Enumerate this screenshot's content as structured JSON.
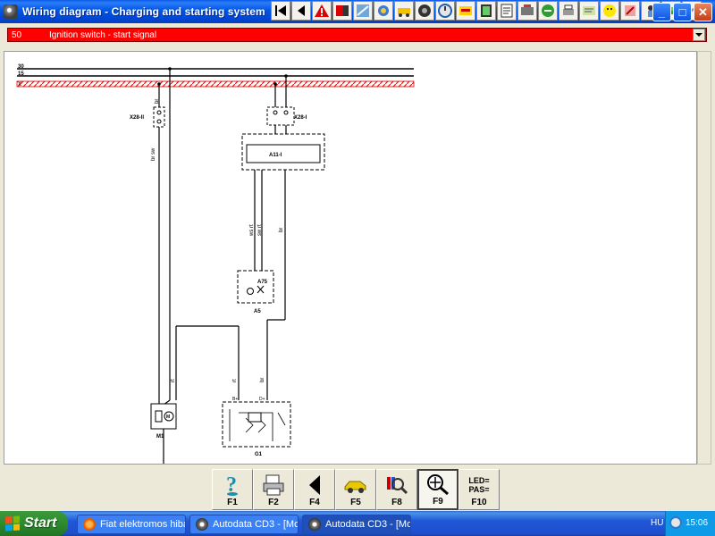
{
  "window": {
    "title": "Wiring diagram - Charging and starting system",
    "min_label": "_",
    "max_label": "□",
    "close_label": "✕"
  },
  "toolbar_icons": [
    "skip-back-icon",
    "back-icon",
    "warning-icon",
    "multimeter-icon",
    "sensor-icon",
    "tool-icon",
    "settings-icon",
    "wheel-icon",
    "timing-icon",
    "gauge-icon",
    "filter-icon",
    "document-icon",
    "engine-icon",
    "components-icon",
    "printer-icon",
    "notes-icon",
    "layout-icon",
    "help-icon",
    "info-icon",
    "car-icon",
    "exit-icon"
  ],
  "signal": {
    "number": "50",
    "label": "Ignition switch - start signal"
  },
  "diagram": {
    "bus": [
      "30",
      "15",
      "X"
    ],
    "conn_left": "X28-II",
    "conn_right": "X28-I",
    "module": "A11-I",
    "a5_code": "A75",
    "a5": "A5",
    "m1": "M1",
    "g1": "G1",
    "wire_br": "br",
    "wire_br_sw": "br sw",
    "wire_rt": "rt",
    "wire_wsrt": "ws rt",
    "wire_swrt": "sw rt",
    "pin_m": "M",
    "pin_b": "B+",
    "pin_d": "D+"
  },
  "fkeys": [
    {
      "label": "F1",
      "icon": "help-icon"
    },
    {
      "label": "F2",
      "icon": "print-icon"
    },
    {
      "label": "F4",
      "icon": "back-arrow-icon"
    },
    {
      "label": "F5",
      "icon": "car-icon"
    },
    {
      "label": "F8",
      "icon": "component-search-icon"
    },
    {
      "label": "F9",
      "icon": "zoom-icon"
    },
    {
      "label": "F10",
      "icon": "led-pas-icon",
      "text1": "LED=",
      "text2": "PAS="
    }
  ],
  "taskbar": {
    "start": "Start",
    "tasks": [
      {
        "label": "Fiat elektromos hiba -...",
        "active": false
      },
      {
        "label": "Autodata CD3 - [Mod...",
        "active": false
      },
      {
        "label": "Autodata CD3 - [Mod...",
        "active": true
      }
    ],
    "language": "HU",
    "clock": "15:06"
  }
}
